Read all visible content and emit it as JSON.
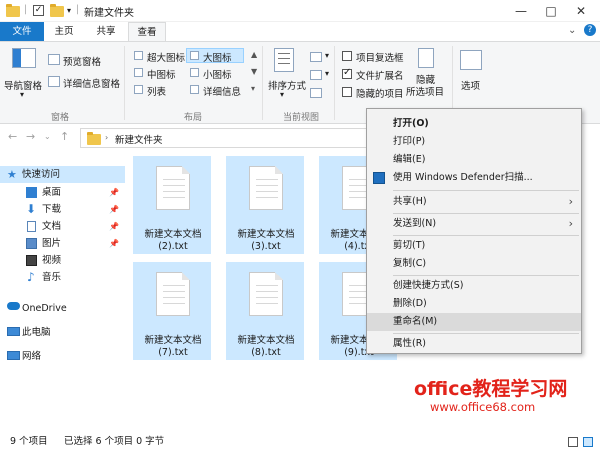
{
  "window": {
    "title": "新建文件夹",
    "minimize": "—",
    "maximize": "□",
    "close": "✕"
  },
  "tabs": [
    "文件",
    "主页",
    "共享",
    "查看"
  ],
  "ribbon": {
    "pane": {
      "nav_pane": "导航窗格",
      "preview": "预览窗格",
      "details": "详细信息窗格",
      "group": "窗格"
    },
    "layout": {
      "items": [
        "超大图标",
        "大图标",
        "中图标",
        "小图标",
        "列表",
        "详细信息"
      ],
      "group": "布局"
    },
    "current_view": {
      "sort": "排序方式",
      "group": "当前视图"
    },
    "show_hide": {
      "item_checkbox": "项目复选框",
      "ext": "文件扩展名",
      "hidden": "隐藏的项目",
      "hide": "隐藏",
      "hide_selected": "所选项目",
      "item_checkbox_checked": false,
      "ext_checked": true,
      "hidden_checked": false
    },
    "options": "选项"
  },
  "address": {
    "path": "新建文件夹"
  },
  "nav": [
    {
      "label": "快速访问",
      "icon": "star-icon"
    },
    {
      "label": "桌面",
      "icon": "desktop-icon"
    },
    {
      "label": "下载",
      "icon": "download-icon"
    },
    {
      "label": "文档",
      "icon": "document-icon"
    },
    {
      "label": "图片",
      "icon": "picture-icon"
    },
    {
      "label": "视频",
      "icon": "video-icon"
    },
    {
      "label": "音乐",
      "icon": "music-icon"
    },
    {
      "label": "OneDrive",
      "icon": "cloud-icon"
    },
    {
      "label": "此电脑",
      "icon": "computer-icon"
    },
    {
      "label": "网络",
      "icon": "network-icon"
    }
  ],
  "files": [
    {
      "line1": "新建文本文档",
      "line2": "(2).txt"
    },
    {
      "line1": "新建文本文档",
      "line2": "(3).txt"
    },
    {
      "line1": "新建文本文档",
      "line2": "(4).txt"
    },
    {
      "line1": "新建文本文档",
      "line2": "(7).txt"
    },
    {
      "line1": "新建文本文档",
      "line2": "(8).txt"
    },
    {
      "line1": "新建文本文档",
      "line2": "(9).txt"
    }
  ],
  "context_menu": {
    "open": "打开(O)",
    "print": "打印(P)",
    "edit": "编辑(E)",
    "defender": "使用 Windows Defender扫描...",
    "share": "共享(H)",
    "send_to": "发送到(N)",
    "cut": "剪切(T)",
    "copy": "复制(C)",
    "shortcut": "创建快捷方式(S)",
    "delete": "删除(D)",
    "rename": "重命名(M)",
    "properties": "属性(R)"
  },
  "status": {
    "count": "9 个项目",
    "selected": "已选择 6 个项目 0 字节"
  },
  "watermark": {
    "line1": "office教程学习网",
    "line2": "www.office68.com"
  }
}
